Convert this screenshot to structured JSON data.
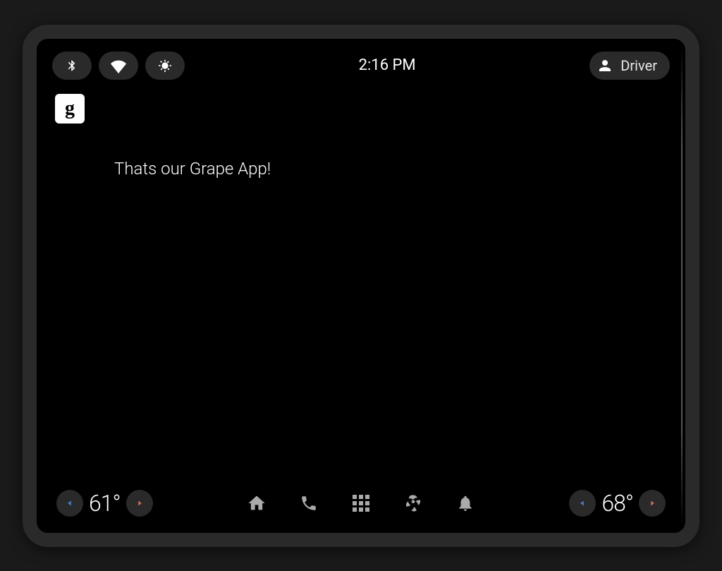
{
  "statusBar": {
    "time": "2:16 PM",
    "userLabel": "Driver"
  },
  "appIcon": {
    "glyph": "g"
  },
  "content": {
    "message": "Thats our Grape App!"
  },
  "bottomBar": {
    "leftTemp": "61°",
    "rightTemp": "68°"
  }
}
